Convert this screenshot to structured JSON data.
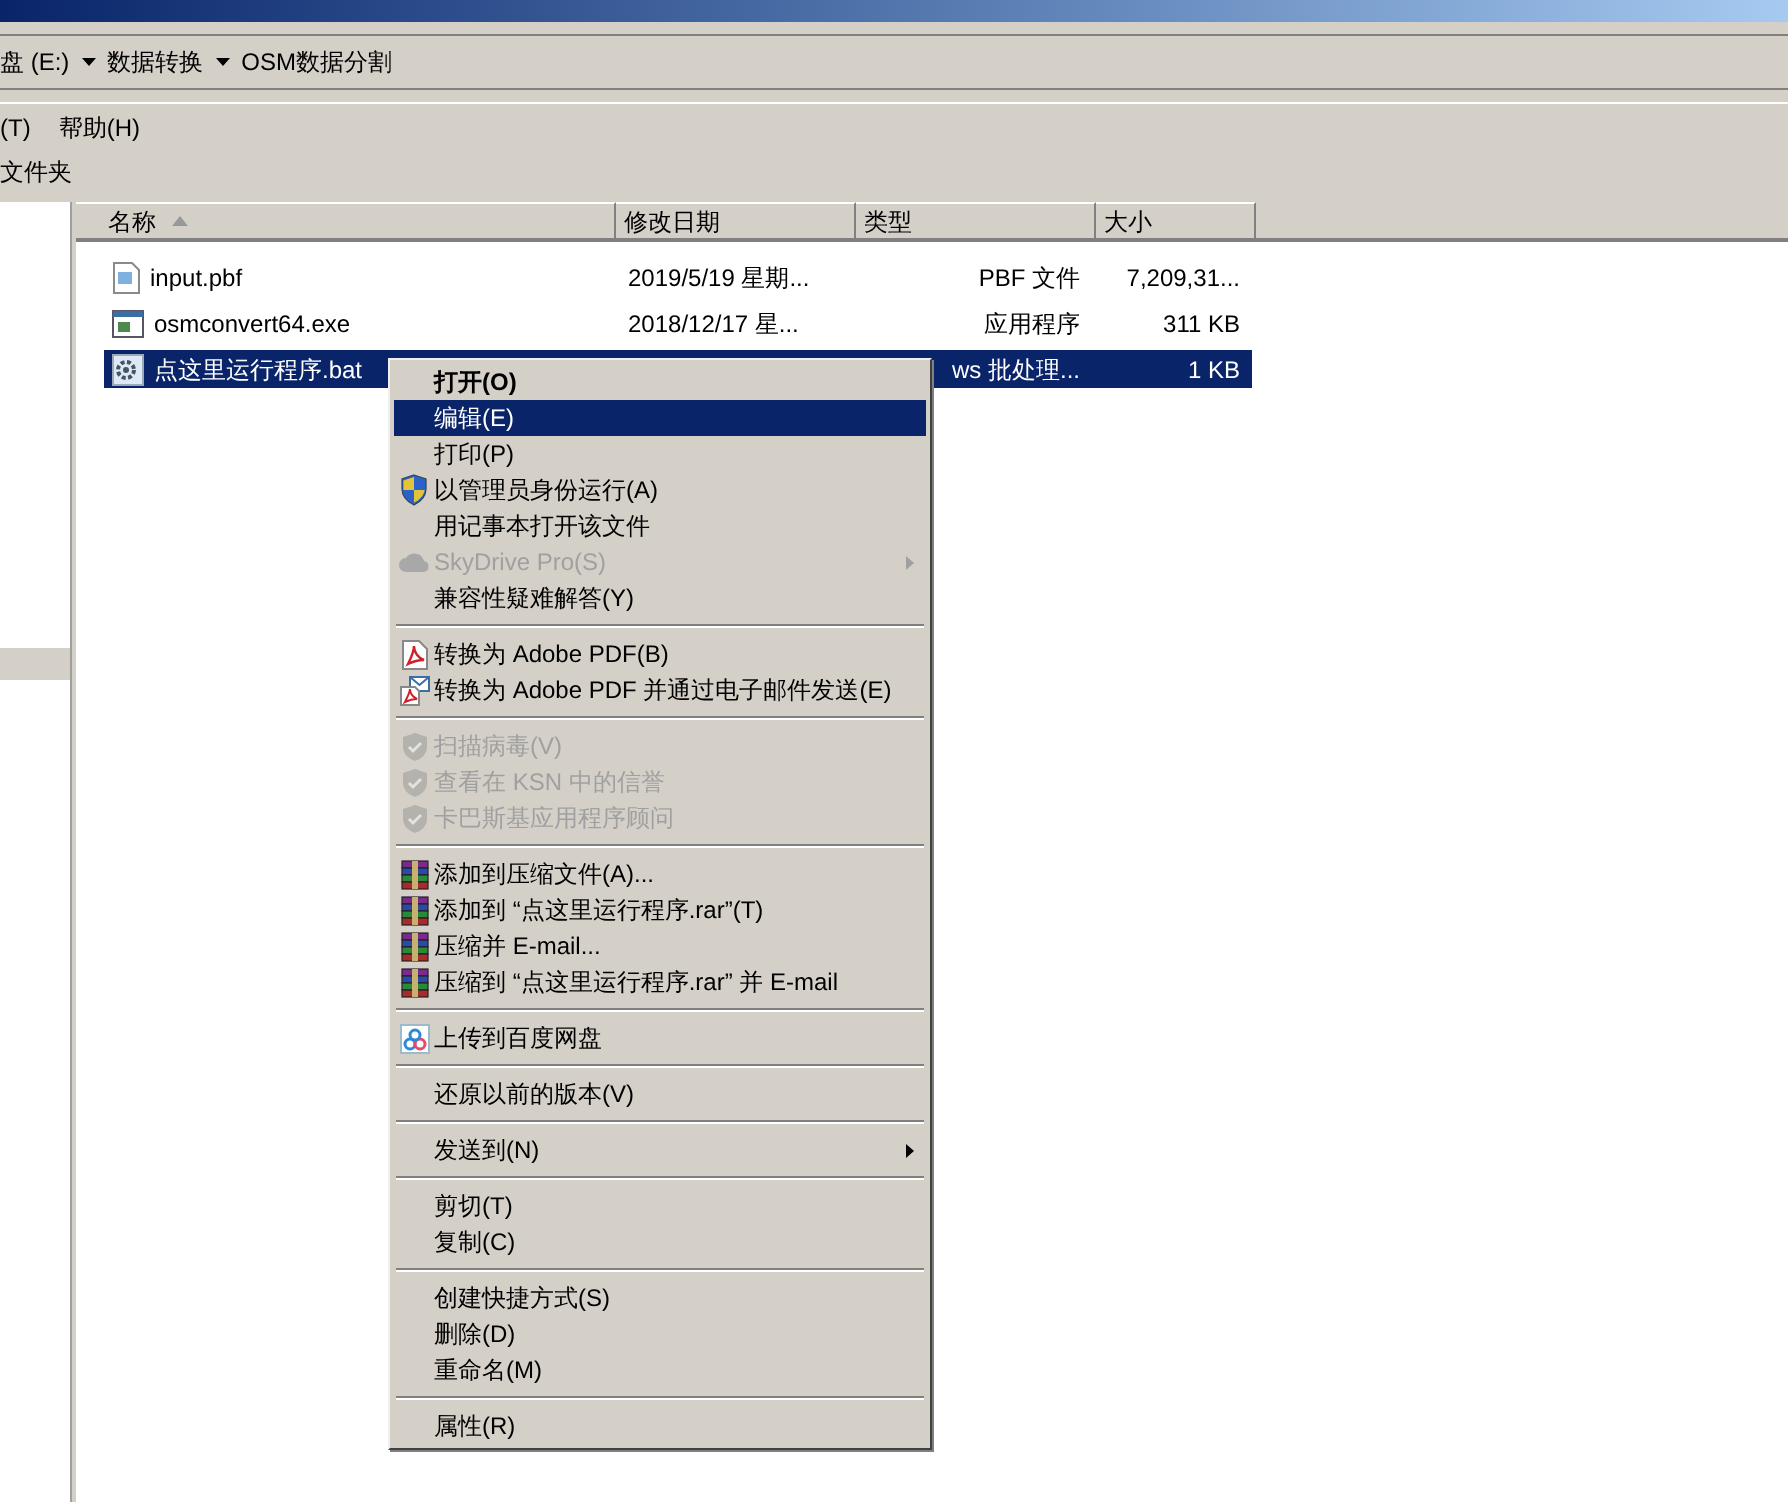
{
  "address_bar": {
    "segments": [
      "盘 (E:)",
      "数据转换",
      "OSM数据分割"
    ]
  },
  "menu_bar": [
    "(T)",
    "帮助(H)"
  ],
  "toolbar": [
    "文件夹"
  ],
  "columns": [
    {
      "label": "名称",
      "sorted": true
    },
    {
      "label": "修改日期",
      "sorted": false
    },
    {
      "label": "类型",
      "sorted": false
    },
    {
      "label": "大小",
      "sorted": false
    }
  ],
  "files": [
    {
      "kind": "image",
      "name": "input.pbf",
      "date": "2019/5/19 星期...",
      "type": "PBF 文件",
      "size": "7,209,31...",
      "selected": false
    },
    {
      "kind": "exe",
      "name": "osmconvert64.exe",
      "date": "2018/12/17 星...",
      "type": "应用程序",
      "size": "311 KB",
      "selected": false
    },
    {
      "kind": "bat",
      "name": "点这里运行程序.bat",
      "type": "ws 批处理...",
      "size": "1 KB",
      "selected": true
    }
  ],
  "context_menu": [
    [
      {
        "kind": "plain",
        "label": "打开(O)",
        "default": true,
        "selected": false,
        "disabled": false,
        "submenu": false
      },
      {
        "kind": "plain",
        "label": "编辑(E)",
        "default": false,
        "selected": true,
        "disabled": false,
        "submenu": false
      },
      {
        "kind": "plain",
        "label": "打印(P)",
        "default": false,
        "selected": false,
        "disabled": false,
        "submenu": false
      },
      {
        "kind": "uac",
        "label": "以管理员身份运行(A)",
        "default": false,
        "selected": false,
        "disabled": false,
        "submenu": false
      },
      {
        "kind": "plain",
        "label": "用记事本打开该文件",
        "default": false,
        "selected": false,
        "disabled": false,
        "submenu": false
      },
      {
        "kind": "cloud",
        "label": "SkyDrive Pro(S)",
        "default": false,
        "selected": false,
        "disabled": true,
        "submenu": true
      },
      {
        "kind": "plain",
        "label": "兼容性疑难解答(Y)",
        "default": false,
        "selected": false,
        "disabled": false,
        "submenu": false
      }
    ],
    [
      {
        "kind": "pdf",
        "label": "转换为 Adobe PDF(B)",
        "default": false,
        "selected": false,
        "disabled": false,
        "submenu": false
      },
      {
        "kind": "pdf-mail",
        "label": "转换为 Adobe PDF 并通过电子邮件发送(E)",
        "default": false,
        "selected": false,
        "disabled": false,
        "submenu": false
      }
    ],
    [
      {
        "kind": "shield",
        "label": "扫描病毒(V)",
        "default": false,
        "selected": false,
        "disabled": true,
        "submenu": false
      },
      {
        "kind": "shield",
        "label": "查看在 KSN 中的信誉",
        "default": false,
        "selected": false,
        "disabled": true,
        "submenu": false
      },
      {
        "kind": "shield",
        "label": "卡巴斯基应用程序顾问",
        "default": false,
        "selected": false,
        "disabled": true,
        "submenu": false
      }
    ],
    [
      {
        "kind": "archive",
        "label": "添加到压缩文件(A)...",
        "default": false,
        "selected": false,
        "disabled": false,
        "submenu": false
      },
      {
        "kind": "archive",
        "label": "添加到 “点这里运行程序.rar”(T)",
        "default": false,
        "selected": false,
        "disabled": false,
        "submenu": false
      },
      {
        "kind": "archive",
        "label": "压缩并 E-mail...",
        "default": false,
        "selected": false,
        "disabled": false,
        "submenu": false
      },
      {
        "kind": "archive",
        "label": "压缩到 “点这里运行程序.rar” 并 E-mail",
        "default": false,
        "selected": false,
        "disabled": false,
        "submenu": false
      }
    ],
    [
      {
        "kind": "upload",
        "label": "上传到百度网盘",
        "default": false,
        "selected": false,
        "disabled": false,
        "submenu": false
      }
    ],
    [
      {
        "kind": "plain",
        "label": "还原以前的版本(V)",
        "default": false,
        "selected": false,
        "disabled": false,
        "submenu": false
      }
    ],
    [
      {
        "kind": "plain",
        "label": "发送到(N)",
        "default": false,
        "selected": false,
        "disabled": false,
        "submenu": true
      }
    ],
    [
      {
        "kind": "plain",
        "label": "剪切(T)",
        "default": false,
        "selected": false,
        "disabled": false,
        "submenu": false
      },
      {
        "kind": "plain",
        "label": "复制(C)",
        "default": false,
        "selected": false,
        "disabled": false,
        "submenu": false
      }
    ],
    [
      {
        "kind": "plain",
        "label": "创建快捷方式(S)",
        "default": false,
        "selected": false,
        "disabled": false,
        "submenu": false
      },
      {
        "kind": "plain",
        "label": "删除(D)",
        "default": false,
        "selected": false,
        "disabled": false,
        "submenu": false
      },
      {
        "kind": "plain",
        "label": "重命名(M)",
        "default": false,
        "selected": false,
        "disabled": false,
        "submenu": false
      }
    ],
    [
      {
        "kind": "plain",
        "label": "属性(R)",
        "default": false,
        "selected": false,
        "disabled": false,
        "submenu": false
      }
    ]
  ]
}
